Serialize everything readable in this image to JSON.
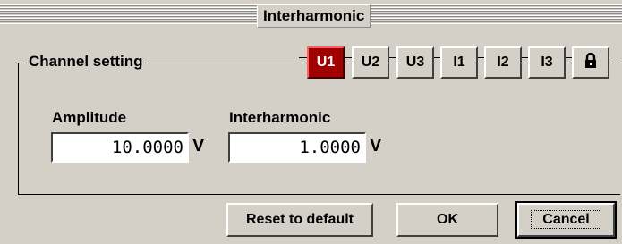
{
  "dialog": {
    "title": "Interharmonic"
  },
  "group": {
    "label": "Channel setting"
  },
  "tabs": [
    {
      "label": "U1",
      "active": true
    },
    {
      "label": "U2",
      "active": false
    },
    {
      "label": "U3",
      "active": false
    },
    {
      "label": "I1",
      "active": false
    },
    {
      "label": "I2",
      "active": false
    },
    {
      "label": "I3",
      "active": false
    }
  ],
  "lock_icon": "lock-icon",
  "fields": {
    "amplitude": {
      "label": "Amplitude",
      "value": "10.0000",
      "unit": "V"
    },
    "interharmonic": {
      "label": "Interharmonic",
      "value": "1.0000",
      "unit": "V"
    }
  },
  "buttons": {
    "reset": "Reset to default",
    "ok": "OK",
    "cancel": "Cancel"
  },
  "colors": {
    "active_tab": "#a00000",
    "background": "#d4d0c8"
  }
}
